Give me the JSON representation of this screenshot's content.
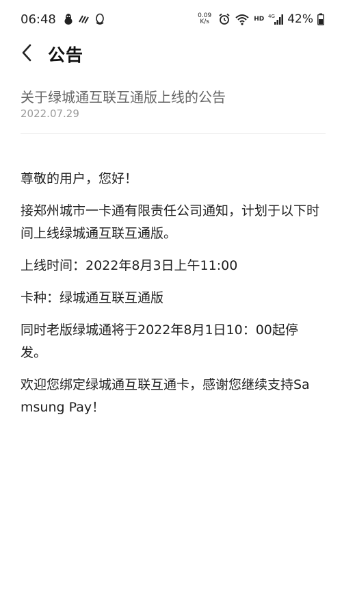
{
  "status_bar": {
    "time": "06:48",
    "net_speed_value": "0.09",
    "net_speed_unit": "K/s",
    "hd": "HD",
    "battery_percent": "42%",
    "icons_left": [
      "qq-penguin-icon",
      "nfc-wave-icon",
      "qq-icon"
    ],
    "icons_right": [
      "alarm-icon",
      "wifi-icon",
      "4g-signal-icon",
      "battery-icon"
    ]
  },
  "header": {
    "title": "公告",
    "back_icon": "chevron-left-icon"
  },
  "article": {
    "title": "关于绿城通互联互通版上线的公告",
    "date": "2022.07.29",
    "paragraphs": [
      "尊敬的用户，您好！",
      "接郑州城市一卡通有限责任公司通知，计划于以下时间上线绿城通互联互通版。",
      "上线时间：2022年8月3日上午11:00",
      "卡种：绿城通互联互通版",
      "同时老版绿城通将于2022年8月1日10：00起停发。",
      "欢迎您绑定绿城通互联互通卡，感谢您继续支持Samsung Pay！"
    ]
  },
  "colors": {
    "title_gray": "#666666",
    "date_gray": "#9a9a9a",
    "divider": "#e6e6e6",
    "text": "#1f1f1f"
  }
}
